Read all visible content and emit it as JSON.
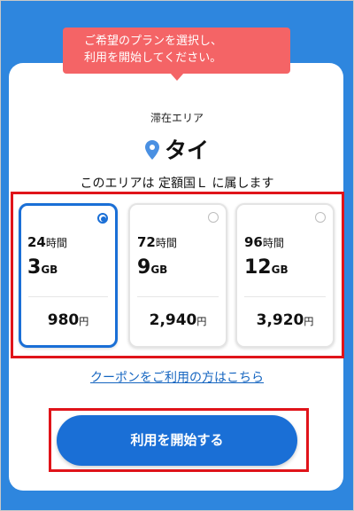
{
  "tooltip": {
    "line1": "ご希望のプランを選択し、",
    "line2": "利用を開始してください。"
  },
  "area": {
    "label": "滞在エリア",
    "country": "タイ",
    "description": "このエリアは 定額国Ｌ に属します"
  },
  "plans": [
    {
      "duration": "24",
      "duration_unit": "時間",
      "data": "3",
      "data_unit": "GB",
      "price": "980",
      "price_unit": "円",
      "selected": true
    },
    {
      "duration": "72",
      "duration_unit": "時間",
      "data": "9",
      "data_unit": "GB",
      "price": "2,940",
      "price_unit": "円",
      "selected": false
    },
    {
      "duration": "96",
      "duration_unit": "時間",
      "data": "12",
      "data_unit": "GB",
      "price": "3,920",
      "price_unit": "円",
      "selected": false
    }
  ],
  "coupon_link": "クーポンをご利用の方はこちら",
  "start_button": "利用を開始する",
  "colors": {
    "accent": "#1a6fd6",
    "tooltip": "#f46466",
    "highlight": "#e0141a",
    "background": "#2e86de"
  }
}
